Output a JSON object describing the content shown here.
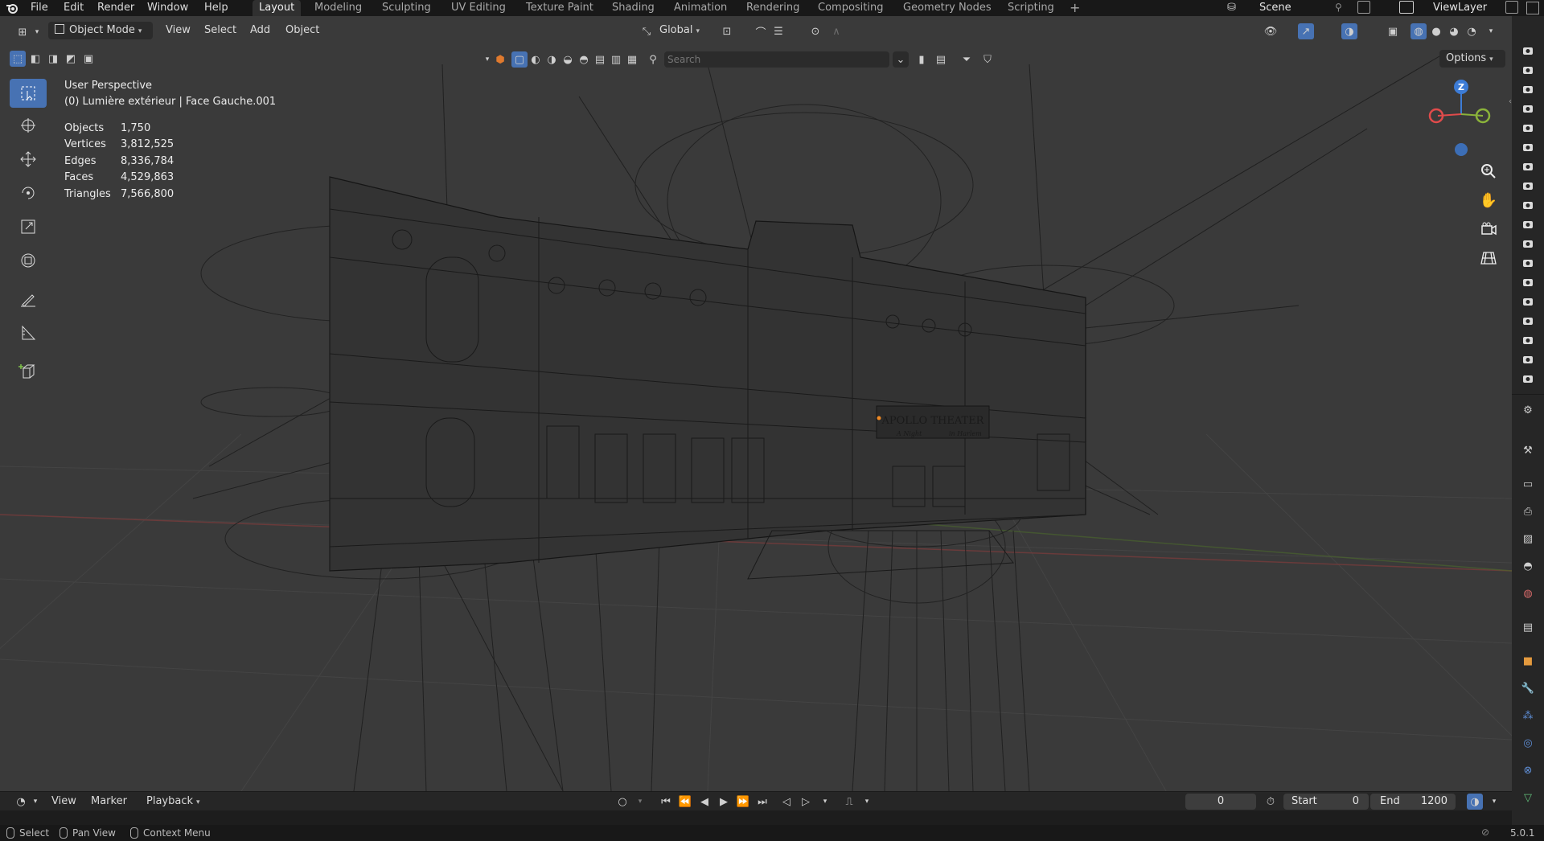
{
  "menu": {
    "items": [
      "File",
      "Edit",
      "Render",
      "Window",
      "Help"
    ]
  },
  "workspaces": {
    "tabs": [
      "Layout",
      "Modeling",
      "Sculpting",
      "UV Editing",
      "Texture Paint",
      "Shading",
      "Animation",
      "Rendering",
      "Compositing",
      "Geometry Nodes",
      "Scripting"
    ],
    "active": "Layout",
    "add": "+"
  },
  "scene": {
    "name": "Scene",
    "view_layer": "ViewLayer"
  },
  "viewport_header": {
    "mode": "Object Mode",
    "menus": [
      "View",
      "Select",
      "Add",
      "Object"
    ],
    "orientation": "Global",
    "search_placeholder": "Search",
    "options": "Options"
  },
  "overlay": {
    "view_name": "User Perspective",
    "context": "(0) Lumière extérieur | Face Gauche.001",
    "stats": [
      {
        "label": "Objects",
        "value": "1,750"
      },
      {
        "label": "Vertices",
        "value": "3,812,525"
      },
      {
        "label": "Edges",
        "value": "8,336,784"
      },
      {
        "label": "Faces",
        "value": "4,529,863"
      },
      {
        "label": "Triangles",
        "value": "7,566,800"
      }
    ]
  },
  "model_sign": {
    "title": "APOLLO THEATER",
    "left": "A Night",
    "right": "in Harlem"
  },
  "gizmo": {
    "z_label": "Z",
    "accent_x": "#e04b4b",
    "accent_y": "#8bb33a",
    "accent_z": "#3d7cd6"
  },
  "timeline": {
    "menus": [
      "View",
      "Marker",
      "Playback"
    ],
    "current_frame": "0",
    "start_label": "Start",
    "start_value": "0",
    "end_label": "End",
    "end_value": "1200"
  },
  "statusbar": {
    "hints": [
      "Select",
      "Pan View",
      "Context Menu"
    ],
    "version": "5.0.1"
  },
  "colors": {
    "accent": "#4772b3",
    "viewport_bg": "#3a3a3a",
    "header_bg": "#181818"
  }
}
